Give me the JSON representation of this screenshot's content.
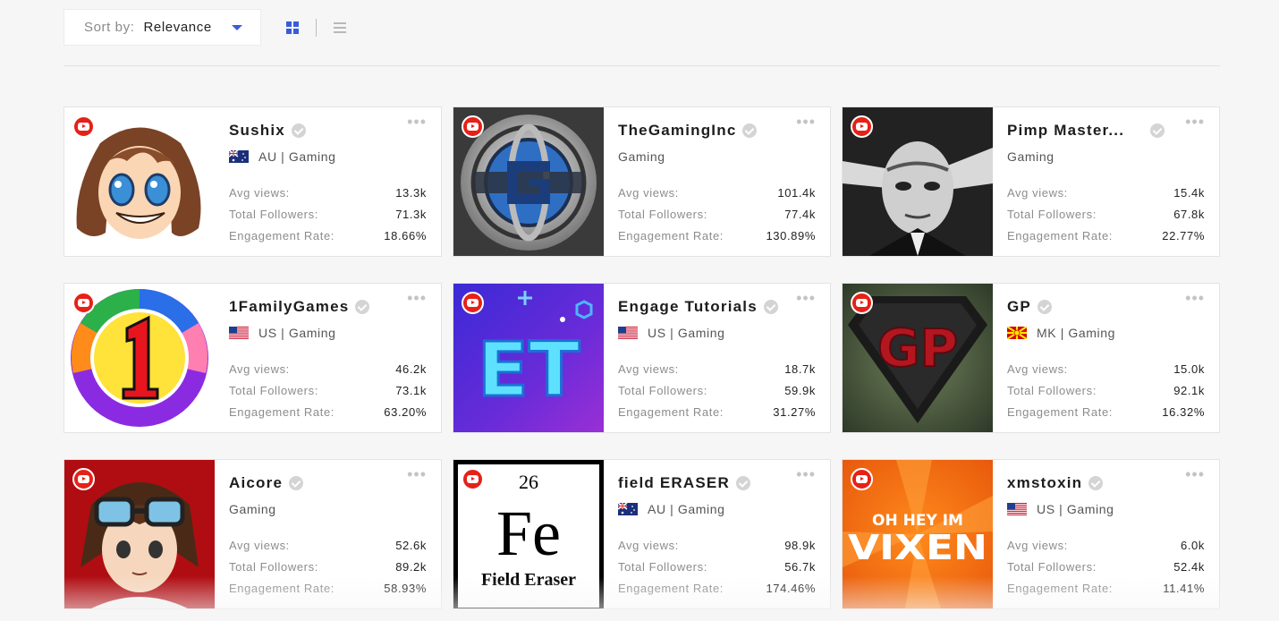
{
  "toolbar": {
    "sort_label": "Sort by:",
    "sort_value": "Relevance",
    "views": [
      "grid-view-icon",
      "list-view-icon"
    ],
    "active_view": "grid"
  },
  "stat_labels": {
    "avg_views": "Avg views:",
    "total_followers": "Total Followers:",
    "engagement": "Engagement Rate:"
  },
  "cards": [
    {
      "name": "Sushix",
      "country": "AU",
      "category": "Gaming",
      "meta": "AU | Gaming",
      "avg_views": "13.3k",
      "followers": "71.3k",
      "engagement": "18.66%",
      "avatar": "cartoon-girl-brown-hair"
    },
    {
      "name": "TheGamingInc",
      "country": "",
      "category": "Gaming",
      "meta": "Gaming",
      "avg_views": "101.4k",
      "followers": "77.4k",
      "engagement": "130.89%",
      "avatar": "metallic-gi-logo"
    },
    {
      "name": "Pimp Master...",
      "country": "",
      "category": "Gaming",
      "meta": "Gaming",
      "avg_views": "15.4k",
      "followers": "67.8k",
      "engagement": "22.77%",
      "avatar": "yoda-black-white"
    },
    {
      "name": "1FamilyGames",
      "country": "US",
      "category": "Gaming",
      "meta": "US | Gaming",
      "avg_views": "46.2k",
      "followers": "73.1k",
      "engagement": "63.20%",
      "avatar": "number-one-rainbow-ring"
    },
    {
      "name": "Engage Tutorials",
      "country": "US",
      "category": "Gaming",
      "meta": "US | Gaming",
      "avg_views": "18.7k",
      "followers": "59.9k",
      "engagement": "31.27%",
      "avatar": "et-neon-logo",
      "avatar_text": "ET"
    },
    {
      "name": "GP",
      "country": "MK",
      "category": "Gaming",
      "meta": "MK | Gaming",
      "avg_views": "15.0k",
      "followers": "92.1k",
      "engagement": "16.32%",
      "avatar": "gp-shield-logo",
      "avatar_text": "GP"
    },
    {
      "name": "Aicore",
      "country": "",
      "category": "Gaming",
      "meta": "Gaming",
      "avg_views": "52.6k",
      "followers": "89.2k",
      "engagement": "58.93%",
      "avatar": "anime-boy-goggles"
    },
    {
      "name": "field ERASER",
      "country": "AU",
      "category": "Gaming",
      "meta": "AU | Gaming",
      "avg_views": "98.9k",
      "followers": "56.7k",
      "engagement": "174.46%",
      "avatar": "periodic-element-fe",
      "avatar_text": {
        "number": "26",
        "symbol": "Fe",
        "caption": "Field Eraser"
      }
    },
    {
      "name": "xmstoxin",
      "country": "US",
      "category": "Gaming",
      "meta": "US | Gaming",
      "avg_views": "6.0k",
      "followers": "52.4k",
      "engagement": "11.41%",
      "avatar": "vixen-orange-banner",
      "avatar_text": {
        "line1": "OH HEY IM",
        "line2": "VIXEN"
      }
    }
  ],
  "colors": {
    "accent": "#3a5bd9",
    "youtube": "#e62117",
    "verified": "#d4d4d4"
  }
}
